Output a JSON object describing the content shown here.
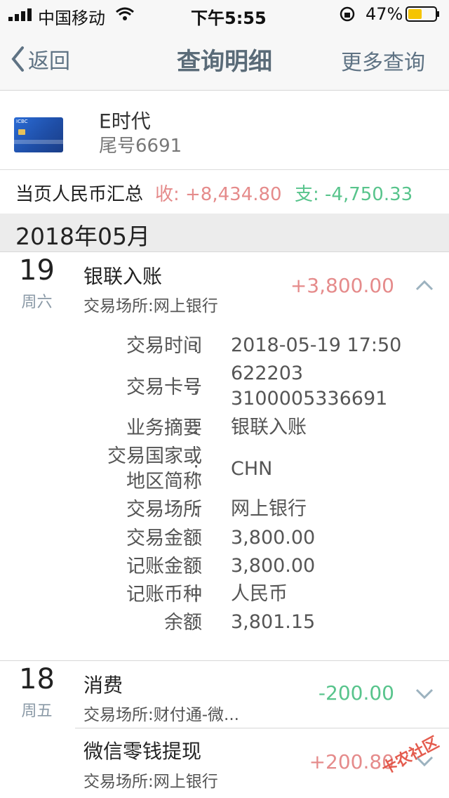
{
  "status_bar": {
    "carrier": "中国移动",
    "time": "下午5:55",
    "battery": "47%"
  },
  "nav": {
    "back_label": "返回",
    "title": "查询明细",
    "more_label": "更多查询"
  },
  "card": {
    "name": "E时代",
    "tail": "尾号6691"
  },
  "summary": {
    "label": "当页人民币汇总",
    "income": "收: +8,434.80",
    "expense": "支: -4,750.33"
  },
  "month": "2018年05月",
  "days": [
    {
      "day": "19",
      "weekday": "周六",
      "txns": [
        {
          "title": "银联入账",
          "place": "交易场所:网上银行",
          "amount": "+3,800.00",
          "direction": "in",
          "expanded": true
        }
      ]
    },
    {
      "day": "18",
      "weekday": "周五",
      "txns": [
        {
          "title": "消费",
          "place": "交易场所:财付通-微...",
          "amount": "-200.00",
          "direction": "out",
          "expanded": false
        },
        {
          "title": "微信零钱提现",
          "place": "交易场所:网上银行",
          "amount": "+200.80",
          "direction": "in",
          "expanded": false
        }
      ]
    }
  ],
  "detail": {
    "colon": ":",
    "rows": [
      {
        "label": "交易时间",
        "value": "2018-05-19 17:50"
      },
      {
        "label": "交易卡号",
        "value_line1": "622203",
        "value_line2": "3100005336691"
      },
      {
        "label": "业务摘要",
        "value": "银联入账"
      },
      {
        "label_line1": "交易国家或",
        "label_line2": "地区简称",
        "value": "CHN"
      },
      {
        "label": "交易场所",
        "value": "网上银行"
      },
      {
        "label": "交易金额",
        "value": "3,800.00"
      },
      {
        "label": "记账金额",
        "value": "3,800.00"
      },
      {
        "label": "记账币种",
        "value": "人民币"
      },
      {
        "label": "余额",
        "value": "3,801.15"
      }
    ]
  },
  "watermark": "卡农社区",
  "colors": {
    "income": "#e58b8b",
    "expense": "#58c48c",
    "nav_text": "#5f7384"
  }
}
